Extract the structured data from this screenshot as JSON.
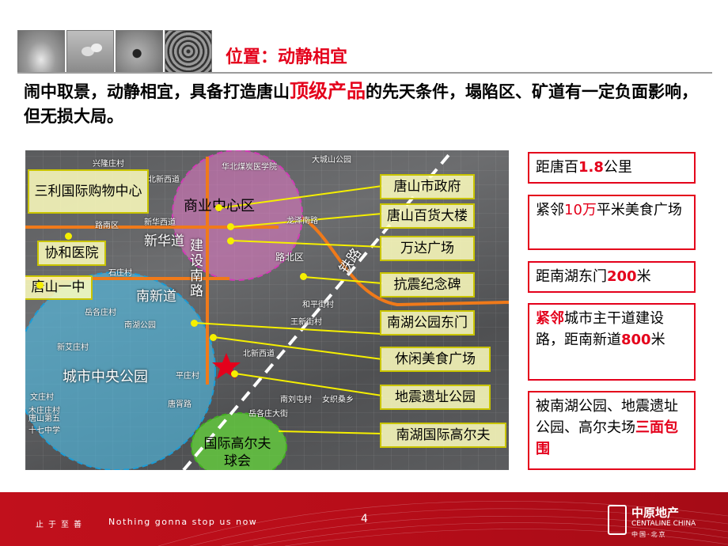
{
  "header": {
    "title": "位置：动静相宜",
    "thumbnails": [
      "sand-image",
      "stones-image",
      "pebble-ripple-image",
      "ripple-image"
    ]
  },
  "intro": {
    "part1": "闹中取景，动静相宜，具备打造唐山",
    "highlight": "顶级产品",
    "part2": "的先天条件，塌陷区、矿道有一定负面影响，但无损大局。",
    "highlight_color": "#e4001b"
  },
  "map": {
    "zones": {
      "business": "商业中心区",
      "park": "城市中央公园",
      "golf": "国际高尔夫球会"
    },
    "road_labels": {
      "xinhua": "新华道",
      "jianshe": "建设南路",
      "nanxin": "南新道",
      "rail": "铁路"
    },
    "left_boxes": [
      "三利国际购物中心",
      "协和医院",
      "唐山一中"
    ],
    "right_boxes": [
      "唐山市政府",
      "唐山百货大楼",
      "万达广场",
      "抗震纪念碑",
      "南湖公园东门",
      "休闲美食广场",
      "地震遗址公园",
      "南湖国际高尔夫"
    ],
    "place_names": [
      "兴隆庄村",
      "大城山公园",
      "华北煤炭医学院",
      "北新西道",
      "路南区",
      "路北区",
      "龙泽南路",
      "新华西道",
      "石庄村",
      "岳各庄村",
      "南湖公园",
      "新艾庄村",
      "平庄村",
      "和平街村",
      "王新街村",
      "北新西道",
      "南刘屯村",
      "女织桑乡",
      "岳各庄大街",
      "唐胥路",
      "唐山第五十七中学",
      "文庄村",
      "木庄庄村"
    ]
  },
  "info_boxes": [
    {
      "pre": "距唐百",
      "red": "1.8",
      "post": "公里"
    },
    {
      "pre": "紧邻",
      "red": "10万",
      "post": "平米美食广场"
    },
    {
      "pre": "距南湖东门",
      "red": "200",
      "post": "米"
    },
    {
      "pre": "",
      "red": "紧邻",
      "post": "城市主干道建设路，距南新道",
      "red2": "800",
      "post2": "米"
    },
    {
      "pre": "被南湖公园、地震遗址公园、高尔夫场",
      "red": "三面包围",
      "post": ""
    }
  ],
  "footer": {
    "slogan_cn": "止于至善",
    "slogan_en": "Nothing gonna stop us now",
    "page_number": "4",
    "logo_cn": "中原地产",
    "logo_en": "CENTALINE CHINA",
    "logo_sub": "中国·北京"
  },
  "colors": {
    "accent": "#e4001b",
    "box_border": "#c9c400",
    "road": "#f07a1a",
    "footer": "#b70d19"
  }
}
